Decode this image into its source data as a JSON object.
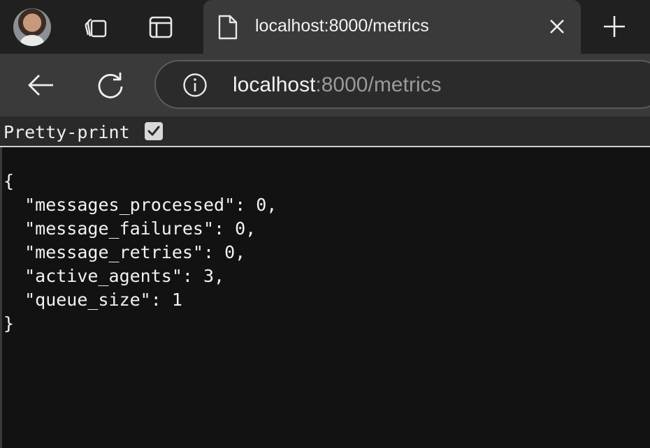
{
  "tab": {
    "title": "localhost:8000/metrics"
  },
  "address_bar": {
    "host": "localhost",
    "rest": ":8000/metrics"
  },
  "viewer": {
    "pretty_print_label": "Pretty-print",
    "pretty_print_checked": true
  },
  "json_lines": [
    "{",
    "  \"messages_processed\": 0,",
    "  \"message_failures\": 0,",
    "  \"message_retries\": 0,",
    "  \"active_agents\": 3,",
    "  \"queue_size\": 1",
    "}"
  ],
  "colors": {
    "tabstrip_bg": "#202020",
    "toolbar_bg": "#3a3a3a",
    "page_bg": "#121212"
  },
  "icons": [
    "profile-avatar",
    "workspaces-icon",
    "vertical-tabs-icon",
    "page-icon",
    "close-icon",
    "plus-icon",
    "back-arrow-icon",
    "refresh-icon",
    "info-icon",
    "checkmark-icon"
  ]
}
